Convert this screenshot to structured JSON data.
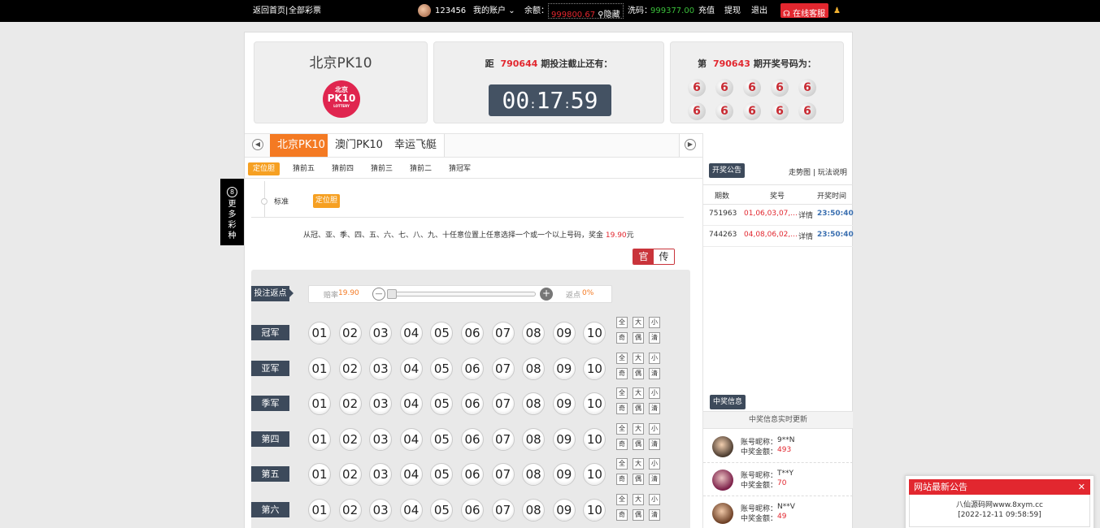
{
  "topbar": {
    "home_link": "返回首页",
    "all_lottery_link": "全部彩票",
    "username": "123456",
    "my_account": "我的账户",
    "balance_label": "余额：",
    "balance_value": "999800.67",
    "hide_label": "隐藏",
    "wash_label": "洗码：",
    "wash_value": "999377.00",
    "recharge": "充值",
    "withdraw": "提现",
    "logout": "退出",
    "online_service": "在线客服"
  },
  "lottery": {
    "name": "北京PK10",
    "logo_line1": "北京",
    "logo_line2": "PK10",
    "logo_line3": "LOTTERY"
  },
  "countdown": {
    "prefix": "距",
    "period": "790644",
    "suffix": "期投注截止还有：",
    "hours": "00",
    "minutes": "17",
    "seconds": "59"
  },
  "result": {
    "prefix": "第",
    "period": "790643",
    "suffix": "期开奖号码为：",
    "balls": [
      "6",
      "6",
      "6",
      "6",
      "6",
      "6",
      "6",
      "6",
      "6",
      "6"
    ]
  },
  "game_tabs": [
    "北京PK10",
    "澳门PK10",
    "幸运飞艇"
  ],
  "sub_tabs": [
    "定位胆",
    "猜前五",
    "猜前四",
    "猜前三",
    "猜前二",
    "猜冠军"
  ],
  "side_tab_label": "更多彩种",
  "mode": {
    "label": "标准",
    "option": "定位胆"
  },
  "rule_text": "从冠、亚、季、四、五、六、七、八、九、十任意位置上任意选择一个或一个以上号码，奖金",
  "rule_prize": "19.90",
  "rule_unit": "元",
  "mode_toggle": [
    "官",
    "传"
  ],
  "rebate": {
    "tag": "投注返点",
    "odds_label": "赔率",
    "odds_value": "19.90",
    "minus": "—",
    "plus": "+",
    "rebate_label": "返点",
    "rebate_value": "0%",
    "slider_position": 0
  },
  "positions": [
    "冠军",
    "亚军",
    "季军",
    "第四",
    "第五",
    "第六"
  ],
  "numbers": [
    "01",
    "02",
    "03",
    "04",
    "05",
    "06",
    "07",
    "08",
    "09",
    "10"
  ],
  "quick_buttons": [
    "全",
    "大",
    "小",
    "奇",
    "偶",
    "清"
  ],
  "draw_panel": {
    "tag": "开奖公告",
    "trend_link": "走势图",
    "separator": "|",
    "rules_link": "玩法说明",
    "headers": [
      "期数",
      "奖号",
      "开奖时间"
    ],
    "rows": [
      {
        "period": "751963",
        "numbers": "01,06,03,07,...",
        "detail": "详情",
        "time": "23:50:40"
      },
      {
        "period": "744263",
        "numbers": "04,08,06,02,...",
        "detail": "详情",
        "time": "23:50:40"
      }
    ]
  },
  "winners_panel": {
    "tag": "中奖信息",
    "subtitle": "中奖信息实时更新",
    "nick_label": "账号昵称：",
    "amount_label": "中奖金额：",
    "winners": [
      {
        "nick": "9**N",
        "amount": "493"
      },
      {
        "nick": "T**Y",
        "amount": "70"
      },
      {
        "nick": "N**V",
        "amount": "49"
      }
    ]
  },
  "notice": {
    "title": "网站最新公告",
    "close": "✕",
    "line1": "八仙源码网www.8xym.cc",
    "line2": "[2022-12-11 09:58:59]"
  },
  "colors": {
    "accent_orange": "#f47a23",
    "accent_red": "#e2272f",
    "dark_tag": "#3d4a5b"
  }
}
